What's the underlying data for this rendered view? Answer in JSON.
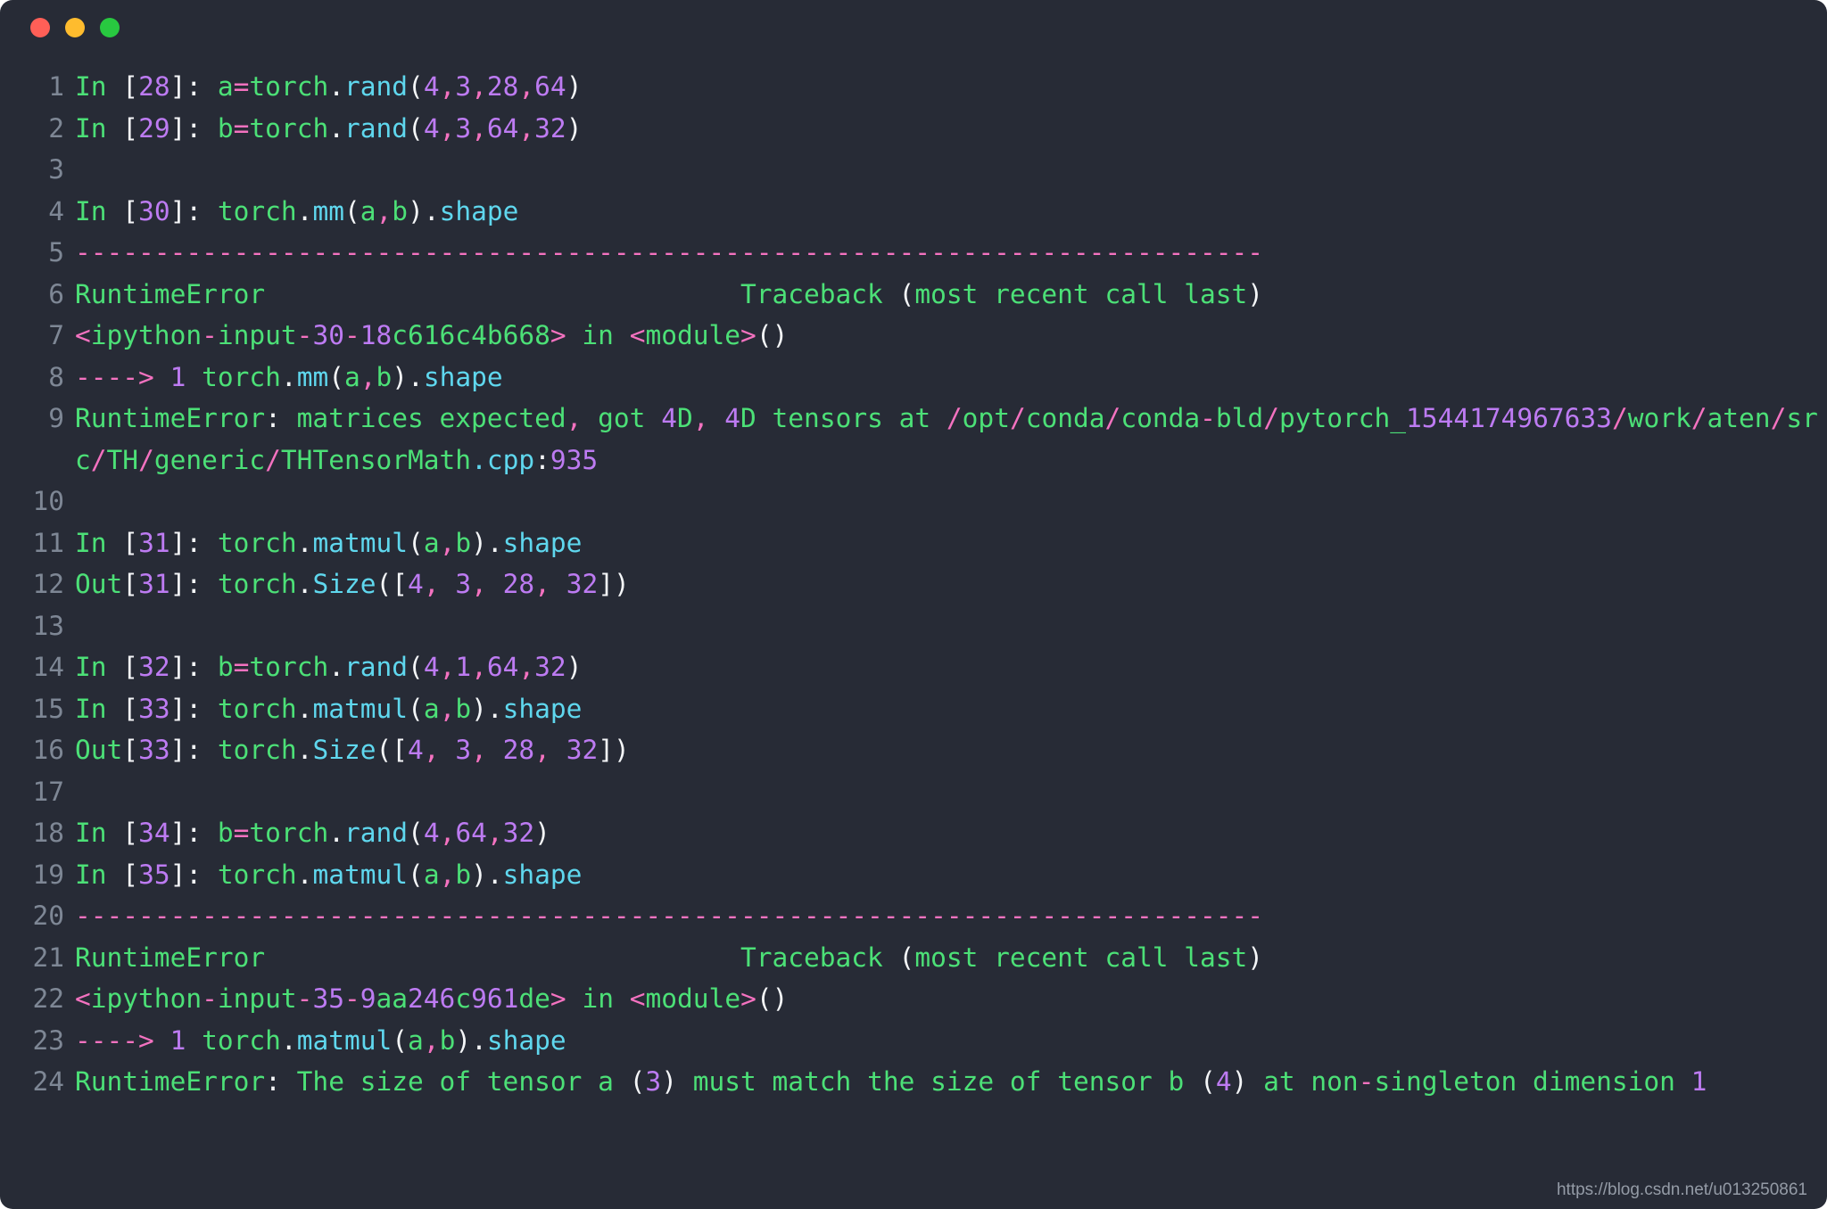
{
  "window": {
    "traffic_lights": [
      {
        "name": "close",
        "color": "#ff5f57"
      },
      {
        "name": "minimize",
        "color": "#febc2e"
      },
      {
        "name": "maximize",
        "color": "#28c840"
      }
    ],
    "background": "#272b36"
  },
  "theme": {
    "green": "#4ce077",
    "white": "#f4f6f8",
    "purple": "#bd7bf2",
    "cyan": "#5fd7ee",
    "pink": "#f472c0",
    "line_number": "#7e8795"
  },
  "watermark": "https://blog.csdn.net/u013250861",
  "lines": [
    {
      "n": "1",
      "text": "In [28]: a=torch.rand(4,3,28,64)"
    },
    {
      "n": "2",
      "text": "In [29]: b=torch.rand(4,3,64,32)"
    },
    {
      "n": "3",
      "text": ""
    },
    {
      "n": "4",
      "text": "In [30]: torch.mm(a,b).shape"
    },
    {
      "n": "5",
      "text": "---------------------------------------------------------------------------"
    },
    {
      "n": "6",
      "text": "RuntimeError                              Traceback (most recent call last)"
    },
    {
      "n": "7",
      "text": "<ipython-input-30-18c616c4b668> in <module>()"
    },
    {
      "n": "8",
      "text": "----> 1 torch.mm(a,b).shape"
    },
    {
      "n": "9",
      "text": "RuntimeError: matrices expected, got 4D, 4D tensors at /opt/conda/conda-bld/pytorch_1544174967633/work/aten/src/TH/generic/THTensorMath.cpp:935"
    },
    {
      "n": "10",
      "text": ""
    },
    {
      "n": "11",
      "text": "In [31]: torch.matmul(a,b).shape"
    },
    {
      "n": "12",
      "text": "Out[31]: torch.Size([4, 3, 28, 32])"
    },
    {
      "n": "13",
      "text": ""
    },
    {
      "n": "14",
      "text": "In [32]: b=torch.rand(4,1,64,32)"
    },
    {
      "n": "15",
      "text": "In [33]: torch.matmul(a,b).shape"
    },
    {
      "n": "16",
      "text": "Out[33]: torch.Size([4, 3, 28, 32])"
    },
    {
      "n": "17",
      "text": ""
    },
    {
      "n": "18",
      "text": "In [34]: b=torch.rand(4,64,32)"
    },
    {
      "n": "19",
      "text": "In [35]: torch.matmul(a,b).shape"
    },
    {
      "n": "20",
      "text": "---------------------------------------------------------------------------"
    },
    {
      "n": "21",
      "text": "RuntimeError                              Traceback (most recent call last)"
    },
    {
      "n": "22",
      "text": "<ipython-input-35-9aa246c961de> in <module>()"
    },
    {
      "n": "23",
      "text": "----> 1 torch.matmul(a,b).shape"
    },
    {
      "n": "24",
      "text": "RuntimeError: The size of tensor a (3) must match the size of tensor b (4) at non-singleton dimension 1"
    }
  ],
  "tokens": {
    "l1": [
      [
        "g",
        "In"
      ],
      [
        "w",
        " ["
      ],
      [
        "p",
        "28"
      ],
      [
        "w",
        "]: "
      ],
      [
        "g",
        "a"
      ],
      [
        "pk",
        "="
      ],
      [
        "g",
        "torch"
      ],
      [
        "w",
        "."
      ],
      [
        "c",
        "rand"
      ],
      [
        "w",
        "("
      ],
      [
        "p",
        "4"
      ],
      [
        "pk",
        ","
      ],
      [
        "p",
        "3"
      ],
      [
        "pk",
        ","
      ],
      [
        "p",
        "28"
      ],
      [
        "pk",
        ","
      ],
      [
        "p",
        "64"
      ],
      [
        "w",
        ")"
      ]
    ],
    "l2": [
      [
        "g",
        "In"
      ],
      [
        "w",
        " ["
      ],
      [
        "p",
        "29"
      ],
      [
        "w",
        "]: "
      ],
      [
        "g",
        "b"
      ],
      [
        "pk",
        "="
      ],
      [
        "g",
        "torch"
      ],
      [
        "w",
        "."
      ],
      [
        "c",
        "rand"
      ],
      [
        "w",
        "("
      ],
      [
        "p",
        "4"
      ],
      [
        "pk",
        ","
      ],
      [
        "p",
        "3"
      ],
      [
        "pk",
        ","
      ],
      [
        "p",
        "64"
      ],
      [
        "pk",
        ","
      ],
      [
        "p",
        "32"
      ],
      [
        "w",
        ")"
      ]
    ],
    "l3": [],
    "l4": [
      [
        "g",
        "In"
      ],
      [
        "w",
        " ["
      ],
      [
        "p",
        "30"
      ],
      [
        "w",
        "]: "
      ],
      [
        "g",
        "torch"
      ],
      [
        "w",
        "."
      ],
      [
        "c",
        "mm"
      ],
      [
        "w",
        "("
      ],
      [
        "g",
        "a"
      ],
      [
        "pk",
        ","
      ],
      [
        "g",
        "b"
      ],
      [
        "w",
        ")."
      ],
      [
        "c",
        "shape"
      ]
    ],
    "l5": [
      [
        "pk",
        "---------------------------------------------------------------------------"
      ]
    ],
    "l6": [
      [
        "g",
        "RuntimeError                              Traceback "
      ],
      [
        "w",
        "("
      ],
      [
        "g",
        "most recent call last"
      ],
      [
        "w",
        ")"
      ]
    ],
    "l7": [
      [
        "pk",
        "<"
      ],
      [
        "g",
        "ipython"
      ],
      [
        "pk",
        "-"
      ],
      [
        "g",
        "input"
      ],
      [
        "pk",
        "-"
      ],
      [
        "p",
        "30"
      ],
      [
        "pk",
        "-"
      ],
      [
        "p",
        "18"
      ],
      [
        "g",
        "c616c4b668"
      ],
      [
        "pk",
        "> "
      ],
      [
        "g",
        "in "
      ],
      [
        "pk",
        "<"
      ],
      [
        "g",
        "module"
      ],
      [
        "pk",
        ">"
      ],
      [
        "w",
        "()"
      ]
    ],
    "l8": [
      [
        "pk",
        "----> "
      ],
      [
        "p",
        "1"
      ],
      [
        "g",
        " torch"
      ],
      [
        "w",
        "."
      ],
      [
        "c",
        "mm"
      ],
      [
        "w",
        "("
      ],
      [
        "g",
        "a"
      ],
      [
        "pk",
        ","
      ],
      [
        "g",
        "b"
      ],
      [
        "w",
        ")."
      ],
      [
        "c",
        "shape"
      ]
    ],
    "l9": [
      [
        "g",
        "RuntimeError"
      ],
      [
        "w",
        ": "
      ],
      [
        "g",
        "matrices expected"
      ],
      [
        "pk",
        ", "
      ],
      [
        "g",
        "got "
      ],
      [
        "p",
        "4"
      ],
      [
        "g",
        "D"
      ],
      [
        "pk",
        ", "
      ],
      [
        "p",
        "4"
      ],
      [
        "g",
        "D tensors at "
      ],
      [
        "pk",
        "/"
      ],
      [
        "g",
        "opt"
      ],
      [
        "pk",
        "/"
      ],
      [
        "g",
        "conda"
      ],
      [
        "pk",
        "/"
      ],
      [
        "g",
        "conda"
      ],
      [
        "pk",
        "-"
      ],
      [
        "g",
        "bld"
      ],
      [
        "pk",
        "/"
      ],
      [
        "g",
        "pytorch_"
      ],
      [
        "p",
        "1544174967633"
      ],
      [
        "pk",
        "/"
      ],
      [
        "g",
        "work"
      ],
      [
        "pk",
        "/"
      ],
      [
        "g",
        "aten"
      ],
      [
        "pk",
        "/"
      ],
      [
        "g",
        "src"
      ],
      [
        "pk",
        "/"
      ],
      [
        "g",
        "TH"
      ],
      [
        "pk",
        "/"
      ],
      [
        "g",
        "generic"
      ],
      [
        "pk",
        "/"
      ],
      [
        "g",
        "THTensorMath"
      ],
      [
        "c",
        "."
      ],
      [
        "c",
        "cpp"
      ],
      [
        "w",
        ":"
      ],
      [
        "p",
        "935"
      ]
    ],
    "l10": [],
    "l11": [
      [
        "g",
        "In"
      ],
      [
        "w",
        " ["
      ],
      [
        "p",
        "31"
      ],
      [
        "w",
        "]: "
      ],
      [
        "g",
        "torch"
      ],
      [
        "w",
        "."
      ],
      [
        "c",
        "matmul"
      ],
      [
        "w",
        "("
      ],
      [
        "g",
        "a"
      ],
      [
        "pk",
        ","
      ],
      [
        "g",
        "b"
      ],
      [
        "w",
        ")."
      ],
      [
        "c",
        "shape"
      ]
    ],
    "l12": [
      [
        "g",
        "Out"
      ],
      [
        "w",
        "["
      ],
      [
        "p",
        "31"
      ],
      [
        "w",
        "]: "
      ],
      [
        "g",
        "torch"
      ],
      [
        "w",
        "."
      ],
      [
        "c",
        "Size"
      ],
      [
        "w",
        "(["
      ],
      [
        "p",
        "4"
      ],
      [
        "pk",
        ", "
      ],
      [
        "p",
        "3"
      ],
      [
        "pk",
        ", "
      ],
      [
        "p",
        "28"
      ],
      [
        "pk",
        ", "
      ],
      [
        "p",
        "32"
      ],
      [
        "w",
        "])"
      ]
    ],
    "l13": [],
    "l14": [
      [
        "g",
        "In"
      ],
      [
        "w",
        " ["
      ],
      [
        "p",
        "32"
      ],
      [
        "w",
        "]: "
      ],
      [
        "g",
        "b"
      ],
      [
        "pk",
        "="
      ],
      [
        "g",
        "torch"
      ],
      [
        "w",
        "."
      ],
      [
        "c",
        "rand"
      ],
      [
        "w",
        "("
      ],
      [
        "p",
        "4"
      ],
      [
        "pk",
        ","
      ],
      [
        "p",
        "1"
      ],
      [
        "pk",
        ","
      ],
      [
        "p",
        "64"
      ],
      [
        "pk",
        ","
      ],
      [
        "p",
        "32"
      ],
      [
        "w",
        ")"
      ]
    ],
    "l15": [
      [
        "g",
        "In"
      ],
      [
        "w",
        " ["
      ],
      [
        "p",
        "33"
      ],
      [
        "w",
        "]: "
      ],
      [
        "g",
        "torch"
      ],
      [
        "w",
        "."
      ],
      [
        "c",
        "matmul"
      ],
      [
        "w",
        "("
      ],
      [
        "g",
        "a"
      ],
      [
        "pk",
        ","
      ],
      [
        "g",
        "b"
      ],
      [
        "w",
        ")."
      ],
      [
        "c",
        "shape"
      ]
    ],
    "l16": [
      [
        "g",
        "Out"
      ],
      [
        "w",
        "["
      ],
      [
        "p",
        "33"
      ],
      [
        "w",
        "]: "
      ],
      [
        "g",
        "torch"
      ],
      [
        "w",
        "."
      ],
      [
        "c",
        "Size"
      ],
      [
        "w",
        "(["
      ],
      [
        "p",
        "4"
      ],
      [
        "pk",
        ", "
      ],
      [
        "p",
        "3"
      ],
      [
        "pk",
        ", "
      ],
      [
        "p",
        "28"
      ],
      [
        "pk",
        ", "
      ],
      [
        "p",
        "32"
      ],
      [
        "w",
        "])"
      ]
    ],
    "l17": [],
    "l18": [
      [
        "g",
        "In"
      ],
      [
        "w",
        " ["
      ],
      [
        "p",
        "34"
      ],
      [
        "w",
        "]: "
      ],
      [
        "g",
        "b"
      ],
      [
        "pk",
        "="
      ],
      [
        "g",
        "torch"
      ],
      [
        "w",
        "."
      ],
      [
        "c",
        "rand"
      ],
      [
        "w",
        "("
      ],
      [
        "p",
        "4"
      ],
      [
        "pk",
        ","
      ],
      [
        "p",
        "64"
      ],
      [
        "pk",
        ","
      ],
      [
        "p",
        "32"
      ],
      [
        "w",
        ")"
      ]
    ],
    "l19": [
      [
        "g",
        "In"
      ],
      [
        "w",
        " ["
      ],
      [
        "p",
        "35"
      ],
      [
        "w",
        "]: "
      ],
      [
        "g",
        "torch"
      ],
      [
        "w",
        "."
      ],
      [
        "c",
        "matmul"
      ],
      [
        "w",
        "("
      ],
      [
        "g",
        "a"
      ],
      [
        "pk",
        ","
      ],
      [
        "g",
        "b"
      ],
      [
        "w",
        ")."
      ],
      [
        "c",
        "shape"
      ]
    ],
    "l20": [
      [
        "pk",
        "---------------------------------------------------------------------------"
      ]
    ],
    "l21": [
      [
        "g",
        "RuntimeError                              Traceback "
      ],
      [
        "w",
        "("
      ],
      [
        "g",
        "most recent call last"
      ],
      [
        "w",
        ")"
      ]
    ],
    "l22": [
      [
        "pk",
        "<"
      ],
      [
        "g",
        "ipython"
      ],
      [
        "pk",
        "-"
      ],
      [
        "g",
        "input"
      ],
      [
        "pk",
        "-"
      ],
      [
        "p",
        "35"
      ],
      [
        "pk",
        "-"
      ],
      [
        "p",
        "9"
      ],
      [
        "g",
        "aa"
      ],
      [
        "p",
        "246"
      ],
      [
        "g",
        "c"
      ],
      [
        "p",
        "961"
      ],
      [
        "g",
        "de"
      ],
      [
        "pk",
        "> "
      ],
      [
        "g",
        "in "
      ],
      [
        "pk",
        "<"
      ],
      [
        "g",
        "module"
      ],
      [
        "pk",
        ">"
      ],
      [
        "w",
        "()"
      ]
    ],
    "l23": [
      [
        "pk",
        "----> "
      ],
      [
        "p",
        "1"
      ],
      [
        "g",
        " torch"
      ],
      [
        "w",
        "."
      ],
      [
        "c",
        "matmul"
      ],
      [
        "w",
        "("
      ],
      [
        "g",
        "a"
      ],
      [
        "pk",
        ","
      ],
      [
        "g",
        "b"
      ],
      [
        "w",
        ")."
      ],
      [
        "c",
        "shape"
      ]
    ],
    "l24": [
      [
        "g",
        "RuntimeError"
      ],
      [
        "w",
        ": "
      ],
      [
        "g",
        "The size of tensor a "
      ],
      [
        "w",
        "("
      ],
      [
        "p",
        "3"
      ],
      [
        "w",
        ")"
      ],
      [
        "g",
        " must match the size of tensor b "
      ],
      [
        "w",
        "("
      ],
      [
        "p",
        "4"
      ],
      [
        "w",
        ")"
      ],
      [
        "g",
        " at non"
      ],
      [
        "pk",
        "-"
      ],
      [
        "g",
        "singleton dimension "
      ],
      [
        "p",
        "1"
      ]
    ]
  }
}
